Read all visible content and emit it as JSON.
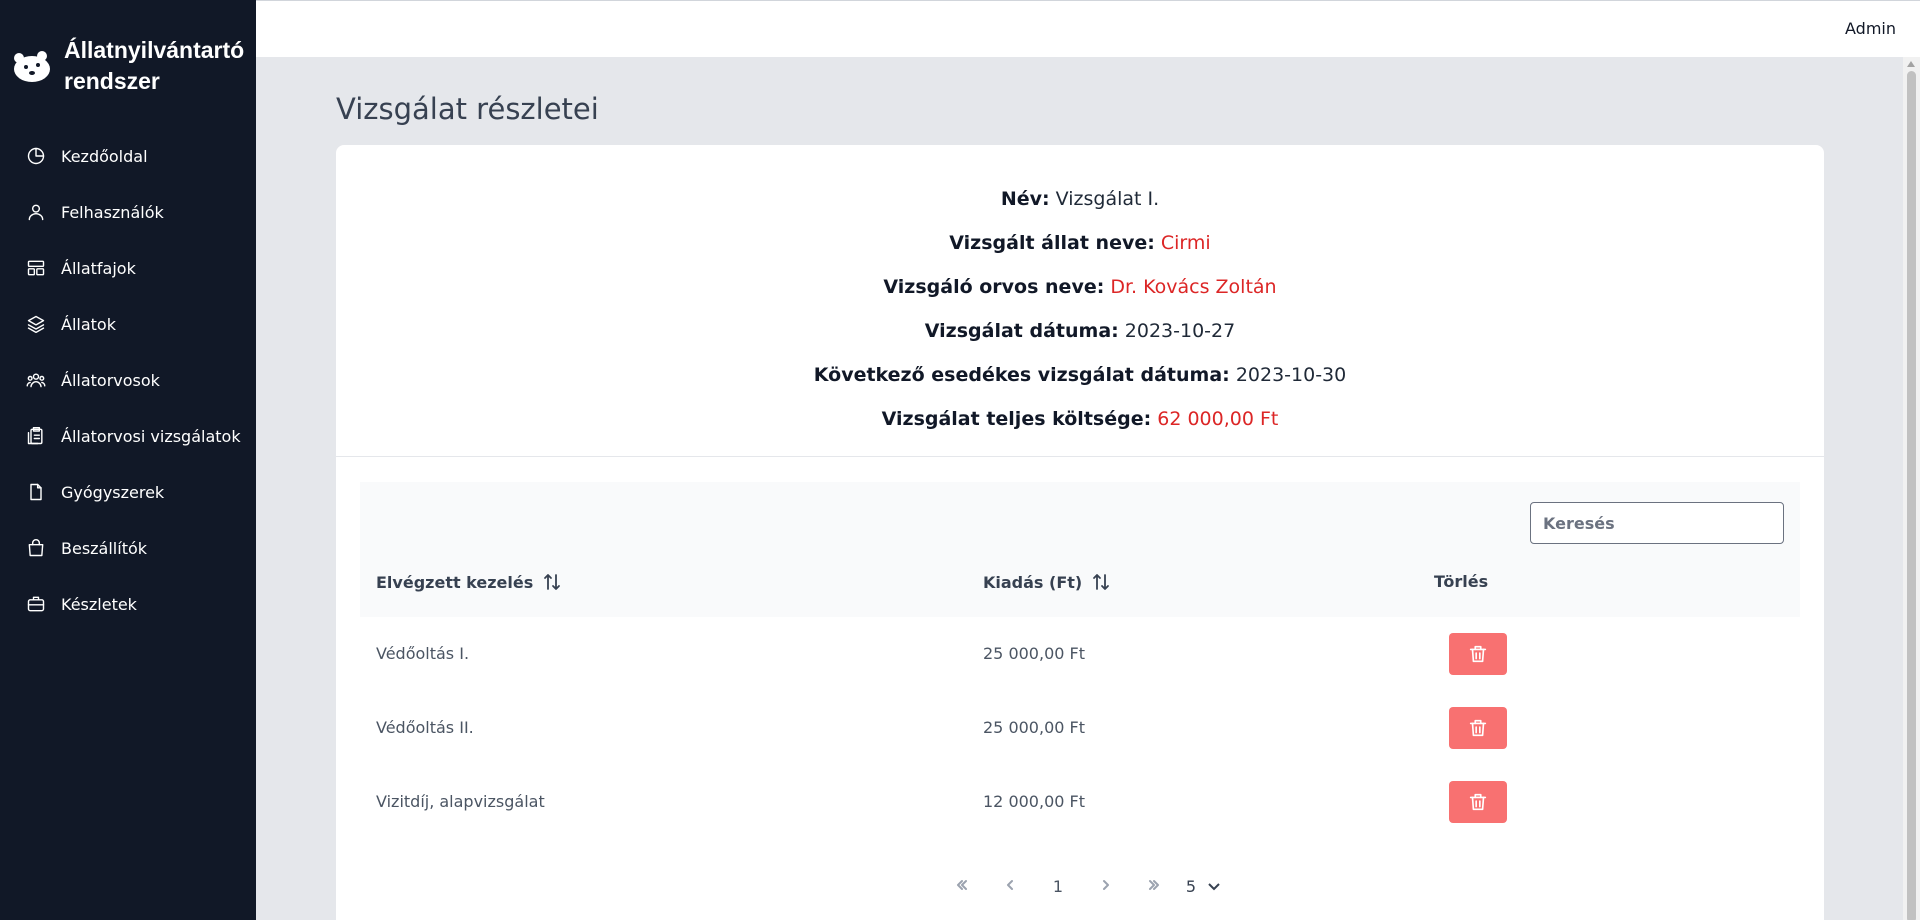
{
  "brand": {
    "title_line1": "Állatnyilvántartó",
    "title_line2": "rendszer",
    "logo_icon": "bear-logo-icon"
  },
  "topbar": {
    "user": "Admin"
  },
  "sidebar": {
    "items": [
      {
        "label": "Kezdőoldal",
        "icon": "pie-chart-icon"
      },
      {
        "label": "Felhasználók",
        "icon": "user-icon"
      },
      {
        "label": "Állatfajok",
        "icon": "layout-icon"
      },
      {
        "label": "Állatok",
        "icon": "layers-icon"
      },
      {
        "label": "Állatorvosok",
        "icon": "users-icon"
      },
      {
        "label": "Állatorvosi vizsgálatok",
        "icon": "clipboard-icon"
      },
      {
        "label": "Gyógyszerek",
        "icon": "document-icon"
      },
      {
        "label": "Beszállítók",
        "icon": "shopping-bag-icon"
      },
      {
        "label": "Készletek",
        "icon": "briefcase-icon"
      }
    ]
  },
  "page": {
    "title": "Vizsgálat részletei"
  },
  "details": {
    "name_label": "Név:",
    "name_value": "Vizsgálat I.",
    "animal_label": "Vizsgált állat neve:",
    "animal_value": "Cirmi",
    "vet_label": "Vizsgáló orvos neve:",
    "vet_value": "Dr. Kovács Zoltán",
    "date_label": "Vizsgálat dátuma:",
    "date_value": "2023-10-27",
    "next_label": "Következő esedékes vizsgálat dátuma:",
    "next_value": "2023-10-30",
    "cost_label": "Vizsgálat teljes költsége:",
    "cost_value": "62 000,00 Ft"
  },
  "table": {
    "search_placeholder": "Keresés",
    "headers": {
      "treatment": "Elvégzett kezelés",
      "expense": "Kiadás (Ft)",
      "delete": "Törlés"
    },
    "rows": [
      {
        "treatment": "Védőoltás I.",
        "expense": "25 000,00 Ft"
      },
      {
        "treatment": "Védőoltás II.",
        "expense": "25 000,00 Ft"
      },
      {
        "treatment": "Vizitdíj, alapvizsgálat",
        "expense": "12 000,00 Ft"
      }
    ]
  },
  "pagination": {
    "current_page": "1",
    "page_size": "5"
  },
  "colors": {
    "sidebar_bg": "#111827",
    "accent_red": "#dc2626",
    "delete_button": "#f87171",
    "page_bg": "#e5e7eb"
  }
}
